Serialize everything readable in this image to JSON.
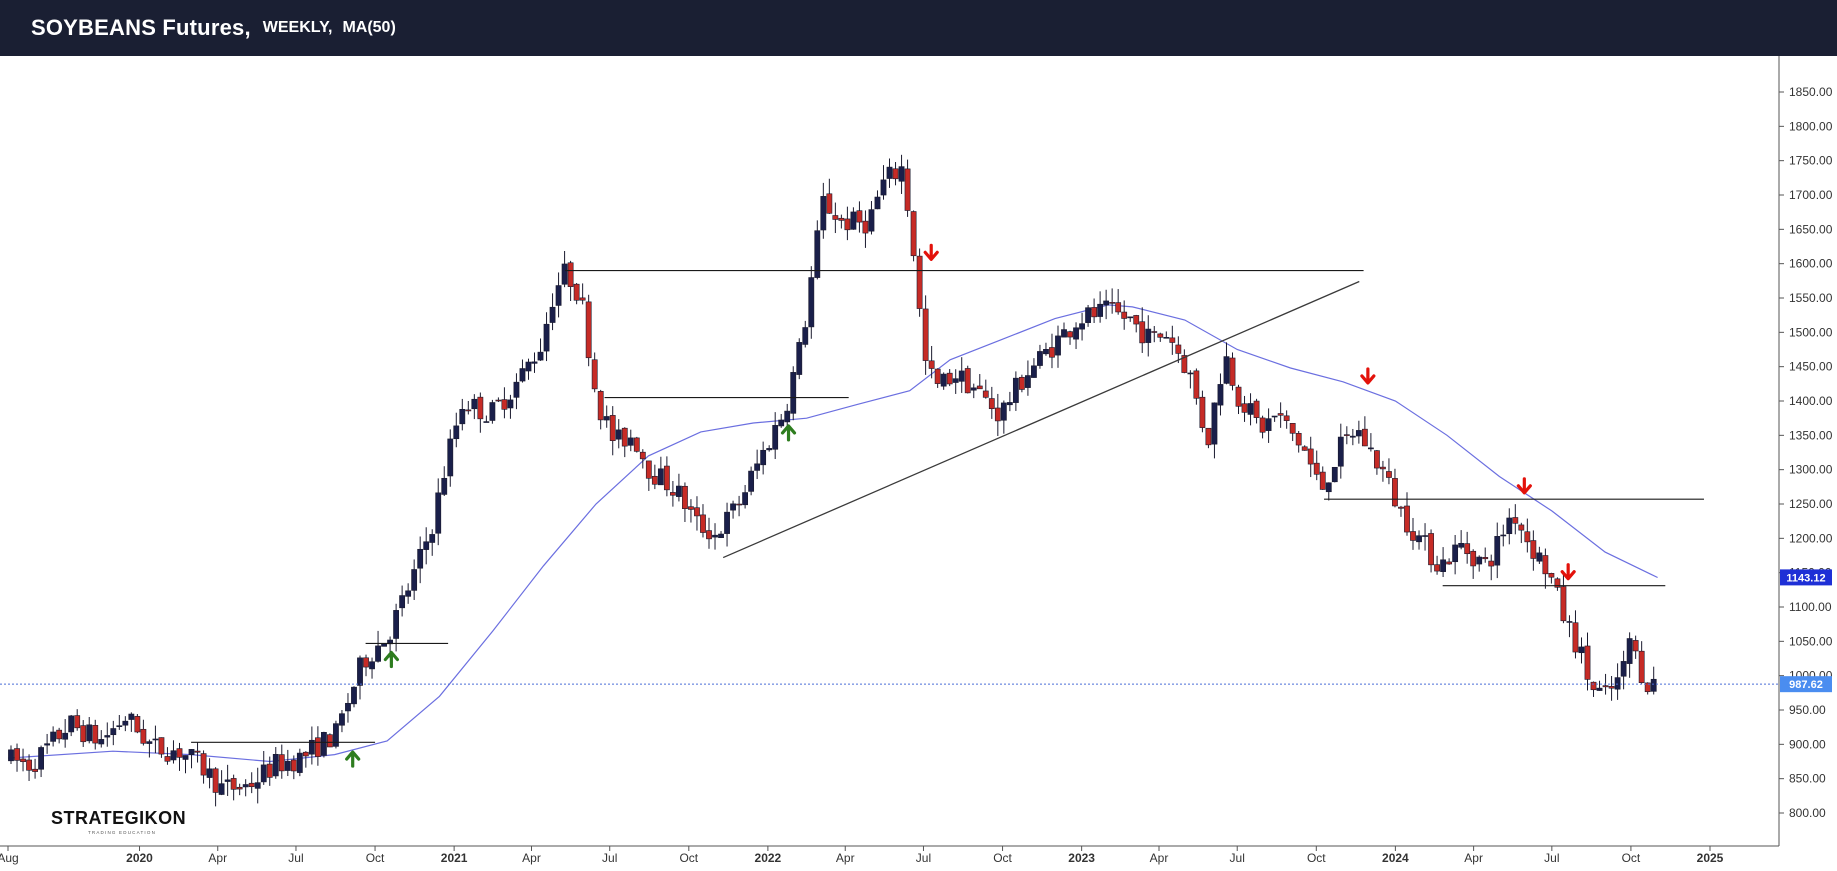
{
  "header": {
    "title": "SOYBEANS Futures,",
    "timeframe": "WEEKLY,",
    "indicator": "MA(50)"
  },
  "watermark": {
    "brand": "STRATEGIKON",
    "tagline": "TRADING EDUCATION"
  },
  "chart_data": {
    "type": "candlestick",
    "title": "SOYBEANS Futures, WEEKLY, MA(50)",
    "ylim": [
      760,
      1890
    ],
    "y_ticks": [
      800,
      850,
      900,
      950,
      1000,
      1050,
      1100,
      1150,
      1200,
      1250,
      1300,
      1350,
      1400,
      1450,
      1500,
      1550,
      1600,
      1650,
      1700,
      1750,
      1800,
      1850
    ],
    "x_ticks": [
      {
        "label": "Aug",
        "date": "2019-08",
        "bold": false
      },
      {
        "label": "2020",
        "date": "2020-01",
        "bold": true
      },
      {
        "label": "Apr",
        "date": "2020-04",
        "bold": false
      },
      {
        "label": "Jul",
        "date": "2020-07",
        "bold": false
      },
      {
        "label": "Oct",
        "date": "2020-10",
        "bold": false
      },
      {
        "label": "2021",
        "date": "2021-01",
        "bold": true
      },
      {
        "label": "Apr",
        "date": "2021-04",
        "bold": false
      },
      {
        "label": "Jul",
        "date": "2021-07",
        "bold": false
      },
      {
        "label": "Oct",
        "date": "2021-10",
        "bold": false
      },
      {
        "label": "2022",
        "date": "2022-01",
        "bold": true
      },
      {
        "label": "Apr",
        "date": "2022-04",
        "bold": false
      },
      {
        "label": "Jul",
        "date": "2022-07",
        "bold": false
      },
      {
        "label": "Oct",
        "date": "2022-10",
        "bold": false
      },
      {
        "label": "2023",
        "date": "2023-01",
        "bold": true
      },
      {
        "label": "Apr",
        "date": "2023-04",
        "bold": false
      },
      {
        "label": "Jul",
        "date": "2023-07",
        "bold": false
      },
      {
        "label": "Oct",
        "date": "2023-10",
        "bold": false
      },
      {
        "label": "2024",
        "date": "2024-01",
        "bold": true
      },
      {
        "label": "Apr",
        "date": "2024-04",
        "bold": false
      },
      {
        "label": "Jul",
        "date": "2024-07",
        "bold": false
      },
      {
        "label": "Oct",
        "date": "2024-10",
        "bold": false
      },
      {
        "label": "2025",
        "date": "2025-01",
        "bold": true
      }
    ],
    "price_path": [
      [
        "2019-08-01",
        880
      ],
      [
        "2019-09-01",
        870
      ],
      [
        "2019-10-15",
        930
      ],
      [
        "2019-11-20",
        905
      ],
      [
        "2019-12-20",
        940
      ],
      [
        "2020-01-20",
        895
      ],
      [
        "2020-02-20",
        890
      ],
      [
        "2020-03-15",
        870
      ],
      [
        "2020-04-10",
        835
      ],
      [
        "2020-05-10",
        840
      ],
      [
        "2020-06-10",
        870
      ],
      [
        "2020-07-10",
        880
      ],
      [
        "2020-08-01",
        900
      ],
      [
        "2020-08-20",
        915
      ],
      [
        "2020-09-20",
        1020
      ],
      [
        "2020-10-20",
        1060
      ],
      [
        "2020-11-20",
        1150
      ],
      [
        "2020-12-10",
        1220
      ],
      [
        "2021-01-01",
        1340
      ],
      [
        "2021-01-15",
        1400
      ],
      [
        "2021-02-15",
        1380
      ],
      [
        "2021-03-15",
        1420
      ],
      [
        "2021-04-15",
        1480
      ],
      [
        "2021-05-01",
        1560
      ],
      [
        "2021-05-15",
        1590
      ],
      [
        "2021-06-01",
        1550
      ],
      [
        "2021-06-20",
        1400
      ],
      [
        "2021-07-10",
        1340
      ],
      [
        "2021-08-01",
        1350
      ],
      [
        "2021-08-20",
        1300
      ],
      [
        "2021-09-20",
        1270
      ],
      [
        "2021-10-15",
        1220
      ],
      [
        "2021-11-05",
        1205
      ],
      [
        "2021-12-01",
        1250
      ],
      [
        "2022-01-01",
        1330
      ],
      [
        "2022-01-25",
        1390
      ],
      [
        "2022-02-15",
        1500
      ],
      [
        "2022-03-01",
        1620
      ],
      [
        "2022-03-10",
        1690
      ],
      [
        "2022-04-01",
        1660
      ],
      [
        "2022-05-01",
        1660
      ],
      [
        "2022-05-20",
        1720
      ],
      [
        "2022-06-10",
        1740
      ],
      [
        "2022-06-25",
        1600
      ],
      [
        "2022-07-05",
        1460
      ],
      [
        "2022-07-20",
        1420
      ],
      [
        "2022-08-10",
        1440
      ],
      [
        "2022-09-01",
        1420
      ],
      [
        "2022-10-01",
        1380
      ],
      [
        "2022-11-01",
        1440
      ],
      [
        "2022-12-01",
        1480
      ],
      [
        "2023-01-01",
        1520
      ],
      [
        "2023-02-01",
        1530
      ],
      [
        "2023-03-01",
        1520
      ],
      [
        "2023-03-25",
        1490
      ],
      [
        "2023-04-15",
        1500
      ],
      [
        "2023-05-10",
        1440
      ],
      [
        "2023-05-31",
        1340
      ],
      [
        "2023-06-20",
        1470
      ],
      [
        "2023-07-05",
        1410
      ],
      [
        "2023-08-01",
        1360
      ],
      [
        "2023-08-20",
        1380
      ],
      [
        "2023-09-20",
        1330
      ],
      [
        "2023-10-10",
        1270
      ],
      [
        "2023-11-01",
        1330
      ],
      [
        "2023-11-20",
        1360
      ],
      [
        "2023-12-20",
        1300
      ],
      [
        "2024-01-10",
        1240
      ],
      [
        "2024-02-01",
        1200
      ],
      [
        "2024-02-25",
        1160
      ],
      [
        "2024-03-20",
        1190
      ],
      [
        "2024-04-20",
        1160
      ],
      [
        "2024-05-20",
        1240
      ],
      [
        "2024-06-10",
        1190
      ],
      [
        "2024-07-01",
        1150
      ],
      [
        "2024-07-20",
        1080
      ],
      [
        "2024-08-05",
        1040
      ],
      [
        "2024-08-20",
        980
      ],
      [
        "2024-09-05",
        970
      ],
      [
        "2024-09-25",
        1000
      ],
      [
        "2024-10-01",
        1060
      ],
      [
        "2024-10-15",
        1010
      ],
      [
        "2024-10-25",
        988
      ]
    ],
    "ma50": [
      [
        "2019-08-01",
        880
      ],
      [
        "2019-12-01",
        890
      ],
      [
        "2020-03-01",
        885
      ],
      [
        "2020-06-01",
        875
      ],
      [
        "2020-08-15",
        885
      ],
      [
        "2020-10-15",
        905
      ],
      [
        "2020-12-15",
        970
      ],
      [
        "2021-02-15",
        1065
      ],
      [
        "2021-04-15",
        1160
      ],
      [
        "2021-06-15",
        1250
      ],
      [
        "2021-08-15",
        1320
      ],
      [
        "2021-10-15",
        1355
      ],
      [
        "2021-12-15",
        1368
      ],
      [
        "2022-02-15",
        1375
      ],
      [
        "2022-04-15",
        1395
      ],
      [
        "2022-06-15",
        1415
      ],
      [
        "2022-08-01",
        1460
      ],
      [
        "2022-10-01",
        1490
      ],
      [
        "2022-12-01",
        1520
      ],
      [
        "2023-02-01",
        1540
      ],
      [
        "2023-03-01",
        1537
      ],
      [
        "2023-05-01",
        1518
      ],
      [
        "2023-07-01",
        1475
      ],
      [
        "2023-09-01",
        1448
      ],
      [
        "2023-11-01",
        1428
      ],
      [
        "2024-01-01",
        1400
      ],
      [
        "2024-03-01",
        1350
      ],
      [
        "2024-05-01",
        1290
      ],
      [
        "2024-07-01",
        1240
      ],
      [
        "2024-09-01",
        1180
      ],
      [
        "2024-11-01",
        1143
      ]
    ],
    "horizontal_levels": [
      {
        "price": 1590,
        "from": "2021-05-10",
        "to": "2023-11-25"
      },
      {
        "price": 1405,
        "from": "2021-06-25",
        "to": "2022-04-05"
      },
      {
        "price": 1047,
        "from": "2020-09-20",
        "to": "2020-12-25"
      },
      {
        "price": 903,
        "from": "2020-03-01",
        "to": "2020-10-01"
      },
      {
        "price": 1257,
        "from": "2023-10-10",
        "to": "2024-12-25"
      },
      {
        "price": 1131,
        "from": "2024-02-25",
        "to": "2024-11-10"
      }
    ],
    "trendline": {
      "from": [
        "2021-11-10",
        1172
      ],
      "to": [
        "2023-11-20",
        1574
      ]
    },
    "arrows": [
      {
        "direction": "up",
        "date": "2020-09-05",
        "price": 880
      },
      {
        "direction": "up",
        "date": "2020-10-20",
        "price": 1025
      },
      {
        "direction": "up",
        "date": "2022-01-25",
        "price": 1355
      },
      {
        "direction": "down",
        "date": "2022-07-10",
        "price": 1615
      },
      {
        "direction": "down",
        "date": "2023-11-30",
        "price": 1435
      },
      {
        "direction": "down",
        "date": "2024-05-30",
        "price": 1275
      },
      {
        "direction": "down",
        "date": "2024-07-20",
        "price": 1150
      }
    ],
    "price_labels": [
      {
        "text": "1143.12",
        "value": 1143.12,
        "color": "#1e2fd6"
      },
      {
        "text": "987.62",
        "value": 987.62,
        "color": "#4a8df0"
      }
    ],
    "current_price": 987.62,
    "colors": {
      "bull": "#1a1f4a",
      "bear": "#c62b26",
      "ma": "#6b6fe0",
      "arrow_up": "#2e7d1f",
      "arrow_down": "#e3120b",
      "dotted": "#4a6ed8"
    }
  }
}
